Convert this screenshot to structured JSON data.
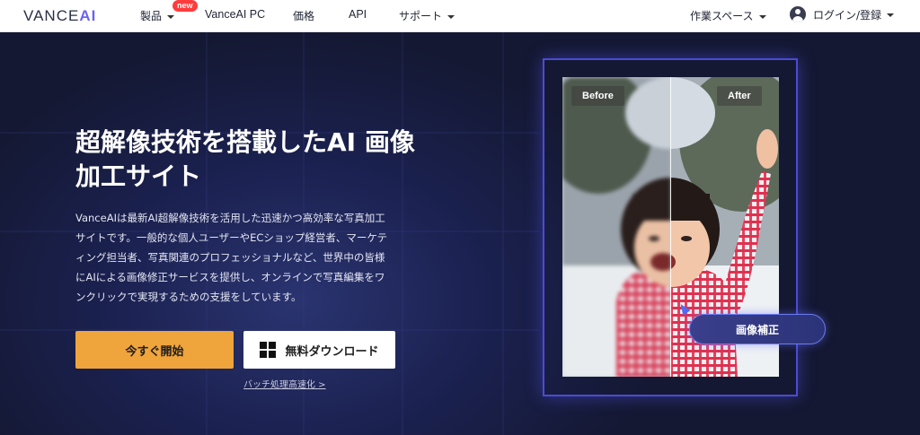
{
  "nav": {
    "logo_main": "VANCE",
    "logo_ai": "AI",
    "items": [
      {
        "label": "製品",
        "has_caret": true
      },
      {
        "label": "VanceAI PC"
      },
      {
        "label": "価格"
      },
      {
        "label": "API"
      },
      {
        "label": "サポート",
        "has_caret": true
      }
    ],
    "new_badge": "new",
    "workspace_label": "作業スペース",
    "login_label": "ログイン/登録"
  },
  "hero": {
    "title_line1": "超解像技術を搭載したAI 画像",
    "title_line2": "加工サイト",
    "description": "VanceAIは最新AI超解像技術を活用した迅速かつ高効率な写真加工サイトです。一般的な個人ユーザーやECショップ経営者、マーケティング担当者、写真関連のプロフェッショナルなど、世界中の皆様にAIによる画像修正サービスを提供し、オンラインで写真編集をワンクリックで実現するための支援をしています。",
    "start_button": "今すぐ開始",
    "download_button": "無料ダウンロード",
    "batch_link": "バッチ処理高速化 >"
  },
  "compare": {
    "before_label": "Before",
    "after_label": "After",
    "enhance_button": "画像補正"
  },
  "colors": {
    "accent_orange": "#f0a43c",
    "brand_purple": "#6a63f3",
    "hero_bg": "#141832",
    "frame_blue": "#4b4bd6"
  }
}
